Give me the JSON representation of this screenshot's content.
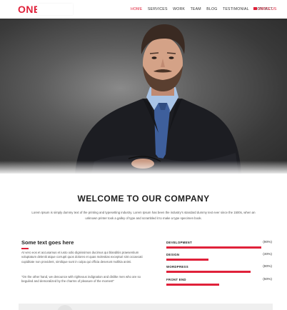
{
  "brand": {
    "logo_text": "ONE"
  },
  "nav": {
    "items": [
      {
        "label": "HOME",
        "active": true
      },
      {
        "label": "SERVICES",
        "active": false
      },
      {
        "label": "WORK",
        "active": false
      },
      {
        "label": "TEAM",
        "active": false
      },
      {
        "label": "BLOG",
        "active": false
      },
      {
        "label": "TESTIMONIAL",
        "active": false
      },
      {
        "label": "CONTACT",
        "active": false
      }
    ],
    "write_us": "WRITE US"
  },
  "hero": {
    "image": "businessman-portrait"
  },
  "welcome": {
    "title": "WELCOME TO OUR COMPANY",
    "text": "Lorem Ipsum is simply dummy text of the printing and typesetting industry. Lorem Ipsum has been the industry's standard dummy text ever since the 1500s, when an unknown printer took a galley of type and scrambled it to make a type specimen book."
  },
  "about": {
    "title": "Some text goes here",
    "paragraph1": "At vero eos et accusamus et iusto odio dignissimos ducimus qui blanditiis praesentium voluptatum deleniti atque corrupti quos dolores et quas molestias excepturi sint occaecati cupiditate non provident, similique sunt in culpa qui officia deserunt mollitia animi.",
    "paragraph2": "\"On the other hand, we denounce with righteous indignation and dislike men who are so beguiled and demoralized by the charms of pleasure of the moment\""
  },
  "skills": [
    {
      "name": "DEVELOPMENT",
      "pct_label": "(90%)",
      "value": 0.9
    },
    {
      "name": "DESIGN",
      "pct_label": "(40%)",
      "value": 0.4
    },
    {
      "name": "WORDPRESS",
      "pct_label": "(80%)",
      "value": 0.8
    },
    {
      "name": "FRONT END",
      "pct_label": "(50%)",
      "value": 0.5
    }
  ],
  "colors": {
    "accent": "#e0213a",
    "text": "#333333"
  }
}
